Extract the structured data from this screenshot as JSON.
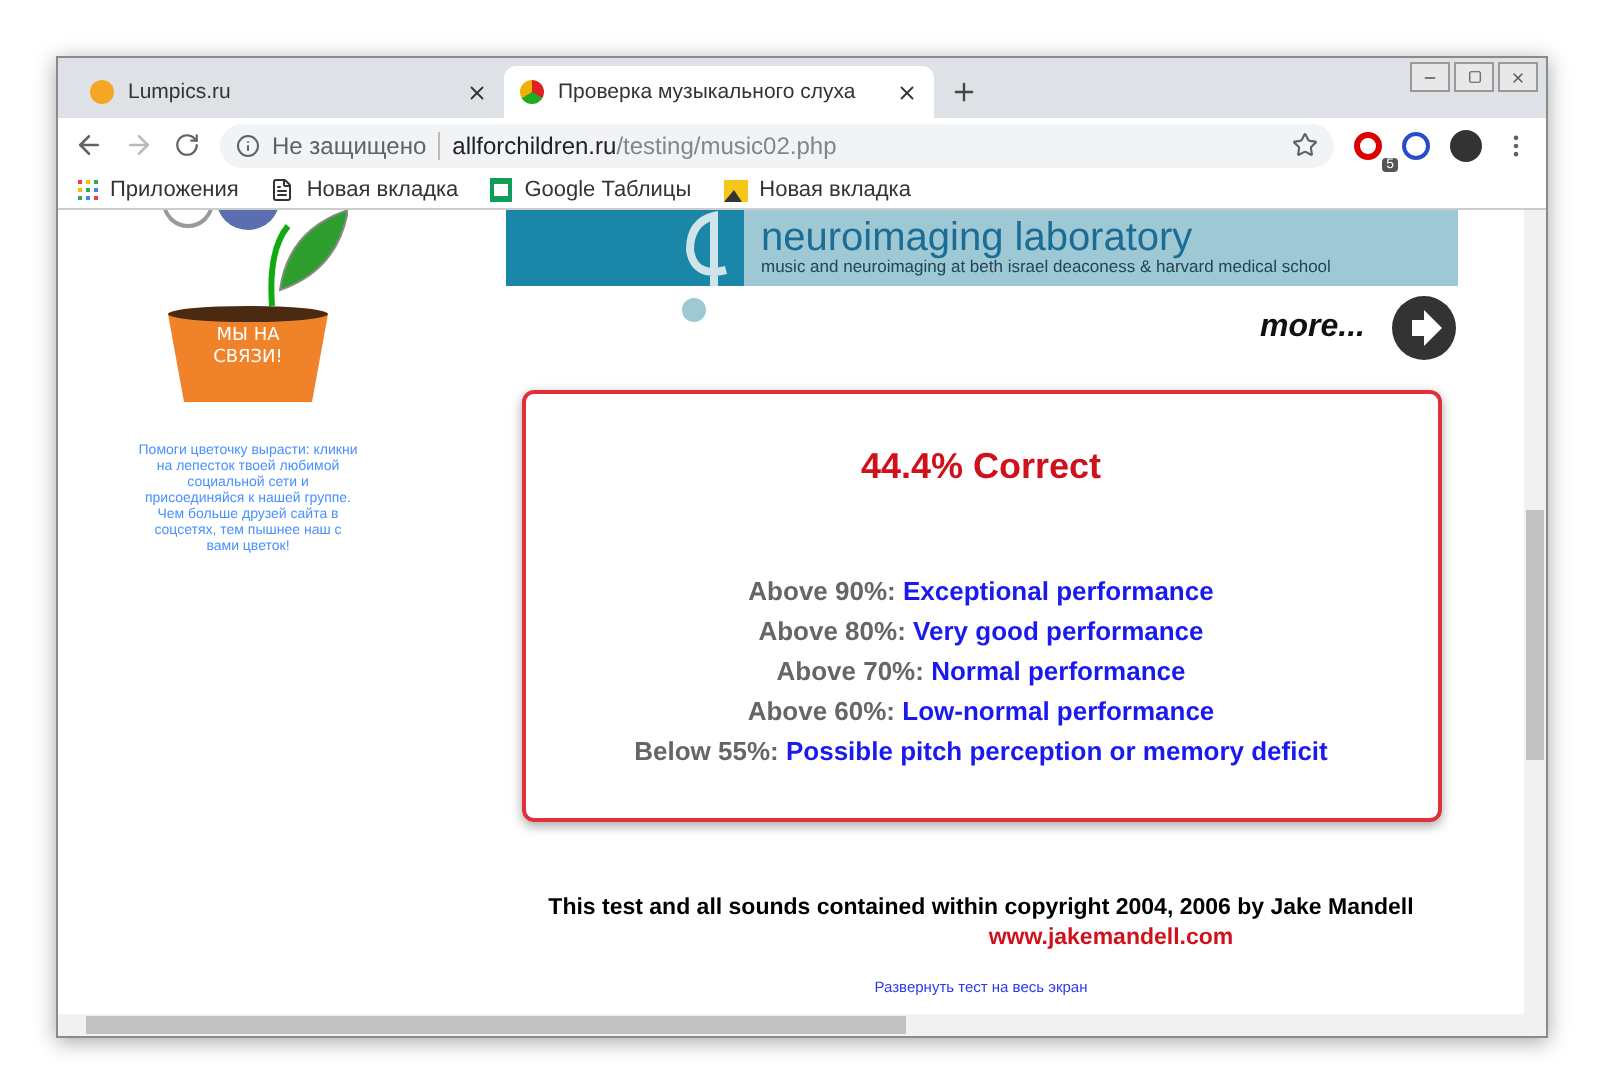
{
  "tabs": [
    {
      "title": "Lumpics.ru",
      "selected": false
    },
    {
      "title": "Проверка музыкального слуха",
      "selected": true
    }
  ],
  "address_bar": {
    "security": "Не защищено",
    "domain": "allforchildren.ru",
    "path": "/testing/music02.php",
    "extension_badge": "5"
  },
  "bookmarks": [
    {
      "label": "Приложения",
      "kind": "apps"
    },
    {
      "label": "Новая вкладка",
      "kind": "page"
    },
    {
      "label": "Google Таблицы",
      "kind": "sheets"
    },
    {
      "label": "Новая вкладка",
      "kind": "image"
    }
  ],
  "sidebar": {
    "pot_text": "МЫ НА СВЯЗИ!",
    "caption": "Помоги цветочку вырасти: кликни на лепесток твоей любимой социальной сети и присоединяйся к нашей группе. Чем больше друзей сайта в соцсетях, тем пышнее наш с вами цветок!"
  },
  "banner": {
    "title": "neuroimaging laboratory",
    "subtitle": "music and neuroimaging at beth israel deaconess & harvard medical school",
    "more": "more..."
  },
  "result": {
    "score": "44.4% Correct",
    "levels": [
      {
        "threshold": "Above 90%:",
        "label": "Exceptional performance"
      },
      {
        "threshold": "Above 80%:",
        "label": "Very good performance"
      },
      {
        "threshold": "Above 70%:",
        "label": "Normal performance"
      },
      {
        "threshold": "Above 60%:",
        "label": "Low-normal performance"
      },
      {
        "threshold": "Below 55%:",
        "label": "Possible pitch perception or memory deficit"
      }
    ]
  },
  "footer": {
    "copyright": "This test and all sounds contained within copyright 2004, 2006 by Jake Mandell",
    "site": "www.jakemandell.com",
    "fullscreen_link": "Развернуть тест на весь экран"
  }
}
